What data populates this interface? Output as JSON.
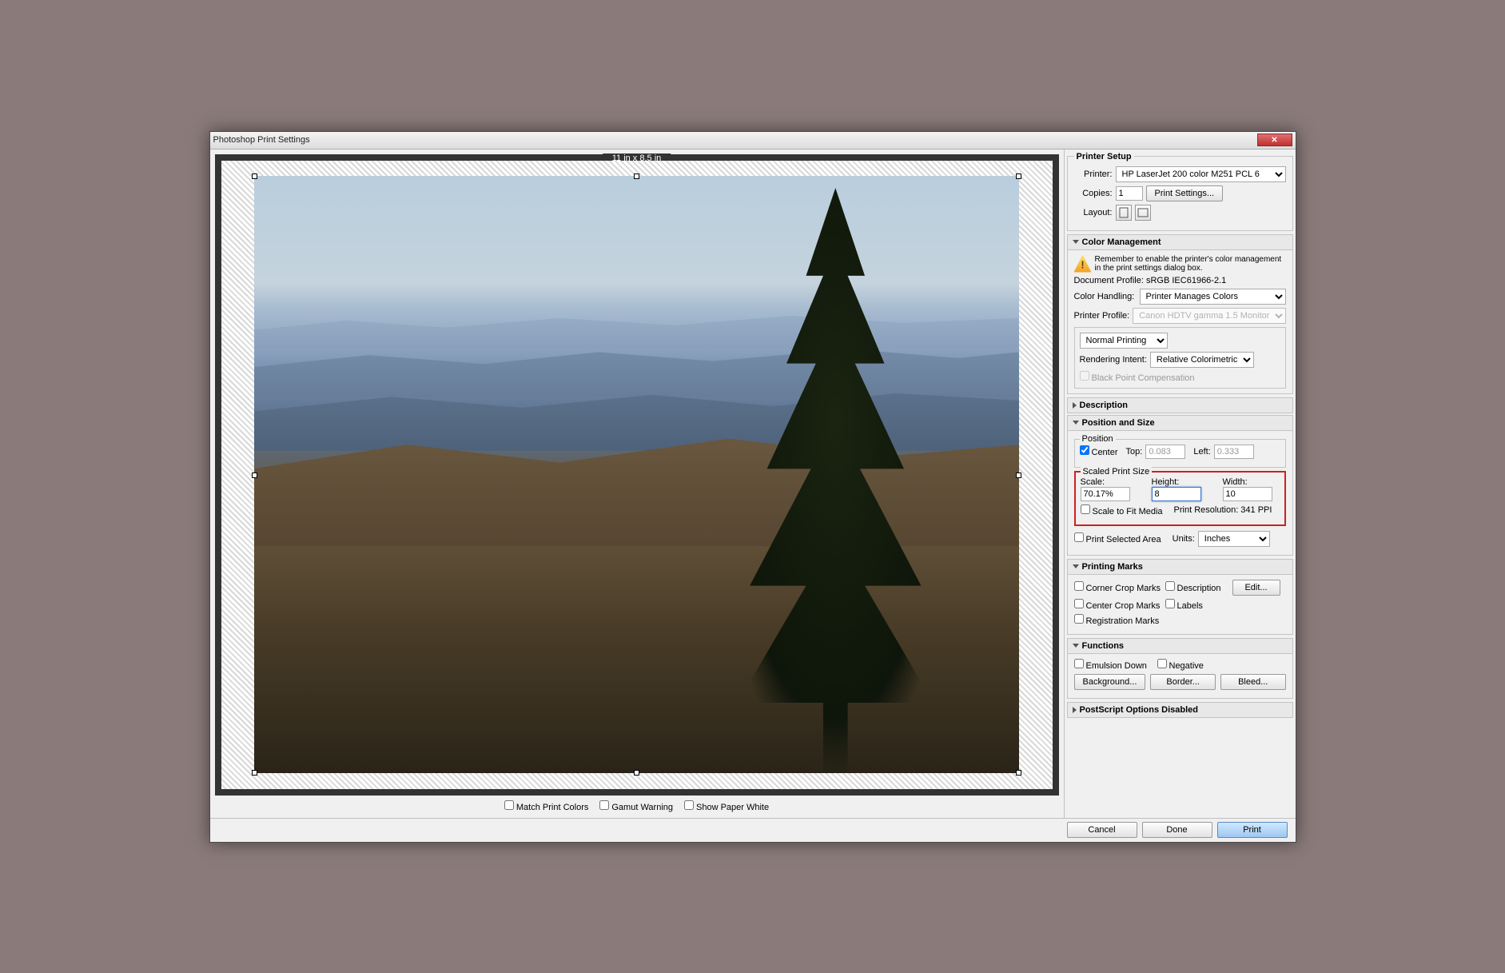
{
  "window_title": "Photoshop Print Settings",
  "preview": {
    "dimensions": "11 in x 8.5 in",
    "match_colors": "Match Print Colors",
    "gamut_warning": "Gamut Warning",
    "show_paper_white": "Show Paper White"
  },
  "printer_setup": {
    "title": "Printer Setup",
    "printer_label": "Printer:",
    "printer_value": "HP LaserJet 200 color M251 PCL 6",
    "copies_label": "Copies:",
    "copies_value": "1",
    "print_settings_btn": "Print Settings...",
    "layout_label": "Layout:"
  },
  "color_mgmt": {
    "title": "Color Management",
    "warning": "Remember to enable the printer's color management in the print settings dialog box.",
    "doc_profile": "Document Profile: sRGB IEC61966-2.1",
    "handling_label": "Color Handling:",
    "handling_value": "Printer Manages Colors",
    "profile_label": "Printer Profile:",
    "profile_value": "Canon HDTV gamma 1.5 Monitor",
    "mode": "Normal Printing",
    "intent_label": "Rendering Intent:",
    "intent_value": "Relative Colorimetric",
    "black_point": "Black Point Compensation"
  },
  "description": {
    "title": "Description"
  },
  "position_size": {
    "title": "Position and Size",
    "position_legend": "Position",
    "center": "Center",
    "top_label": "Top:",
    "top_value": "0.083",
    "left_label": "Left:",
    "left_value": "0.333",
    "scaled_legend": "Scaled Print Size",
    "scale_label": "Scale:",
    "scale_value": "70.17%",
    "height_label": "Height:",
    "height_value": "8",
    "width_label": "Width:",
    "width_value": "10",
    "scale_fit": "Scale to Fit Media",
    "resolution": "Print Resolution: 341 PPI",
    "print_selected": "Print Selected Area",
    "units_label": "Units:",
    "units_value": "Inches"
  },
  "marks": {
    "title": "Printing Marks",
    "corner_crop": "Corner Crop Marks",
    "description_m": "Description",
    "edit_btn": "Edit...",
    "center_crop": "Center Crop Marks",
    "labels_m": "Labels",
    "registration": "Registration Marks"
  },
  "functions": {
    "title": "Functions",
    "emulsion": "Emulsion Down",
    "negative": "Negative",
    "background_btn": "Background...",
    "border_btn": "Border...",
    "bleed_btn": "Bleed..."
  },
  "postscript": {
    "title": "PostScript Options Disabled"
  },
  "footer": {
    "cancel": "Cancel",
    "done": "Done",
    "print": "Print"
  }
}
